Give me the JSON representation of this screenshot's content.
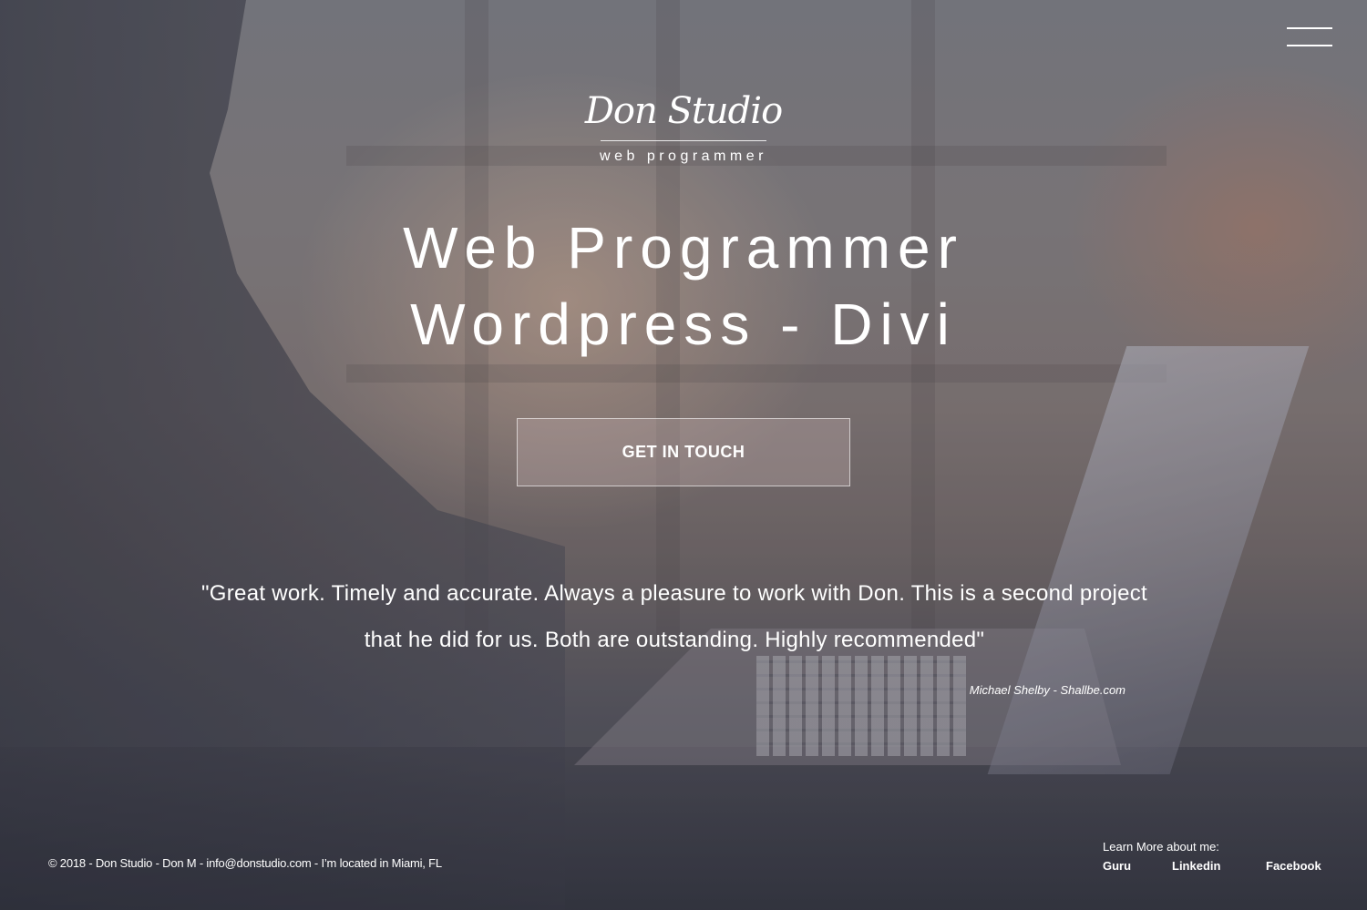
{
  "header": {
    "menu_icon": "hamburger-menu-icon"
  },
  "logo": {
    "name": "Don Studio",
    "tagline": "web programmer"
  },
  "hero": {
    "title_line1": "Web Programmer",
    "title_line2": "Wordpress - Divi",
    "cta_label": "GET IN TOUCH"
  },
  "testimonial": {
    "quote": "\"Great work. Timely and accurate. Always a pleasure to work with Don. This is a second project that he did for us. Both are outstanding. Highly recommended\"",
    "author": "Michael Shelby - Shallbe.com"
  },
  "footer": {
    "copyright": "© 2018 - Don Studio - Don M - info@donstudio.com - I’m located in Miami, FL",
    "learn_more": "Learn More about me:",
    "links": [
      "Guru",
      "Linkedin",
      "Facebook"
    ]
  },
  "colors": {
    "text": "#ffffff",
    "overlay": "#4a4c55"
  }
}
